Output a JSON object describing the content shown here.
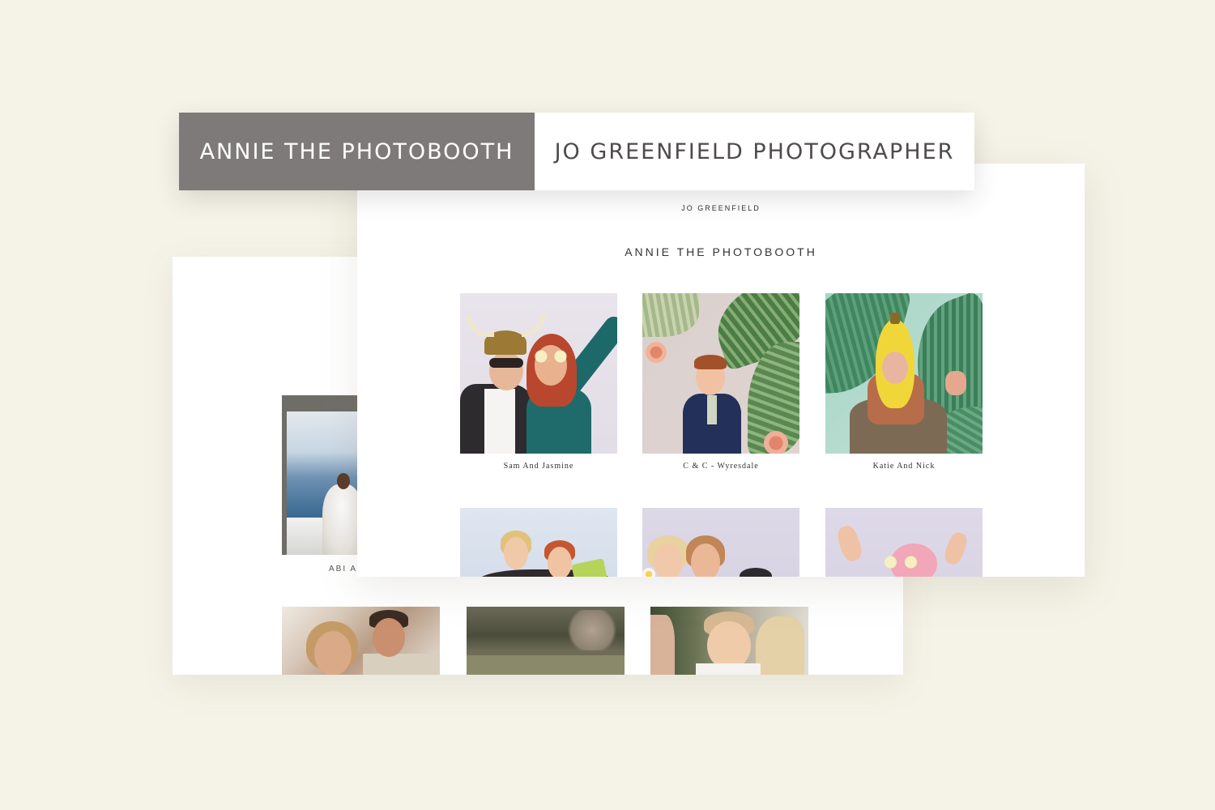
{
  "tabs": [
    {
      "label": "ANNIE THE PHOTOBOOTH",
      "active": true
    },
    {
      "label": "JO GREENFIELD PHOTOGRAPHER",
      "active": false
    }
  ],
  "front_site": {
    "brand": "JO GREENFIELD",
    "gallery_title": "ANNIE THE PHOTOBOOTH",
    "galleries": [
      {
        "caption": "Sam And Jasmine"
      },
      {
        "caption": "C & C - Wyresdale"
      },
      {
        "caption": "Katie And Nick"
      }
    ]
  },
  "back_site": {
    "feature_caption": "ABI AN"
  },
  "colors": {
    "background": "#f5f2e7",
    "active_tab": "#7e7a7a",
    "inactive_tab": "#ffffff"
  }
}
